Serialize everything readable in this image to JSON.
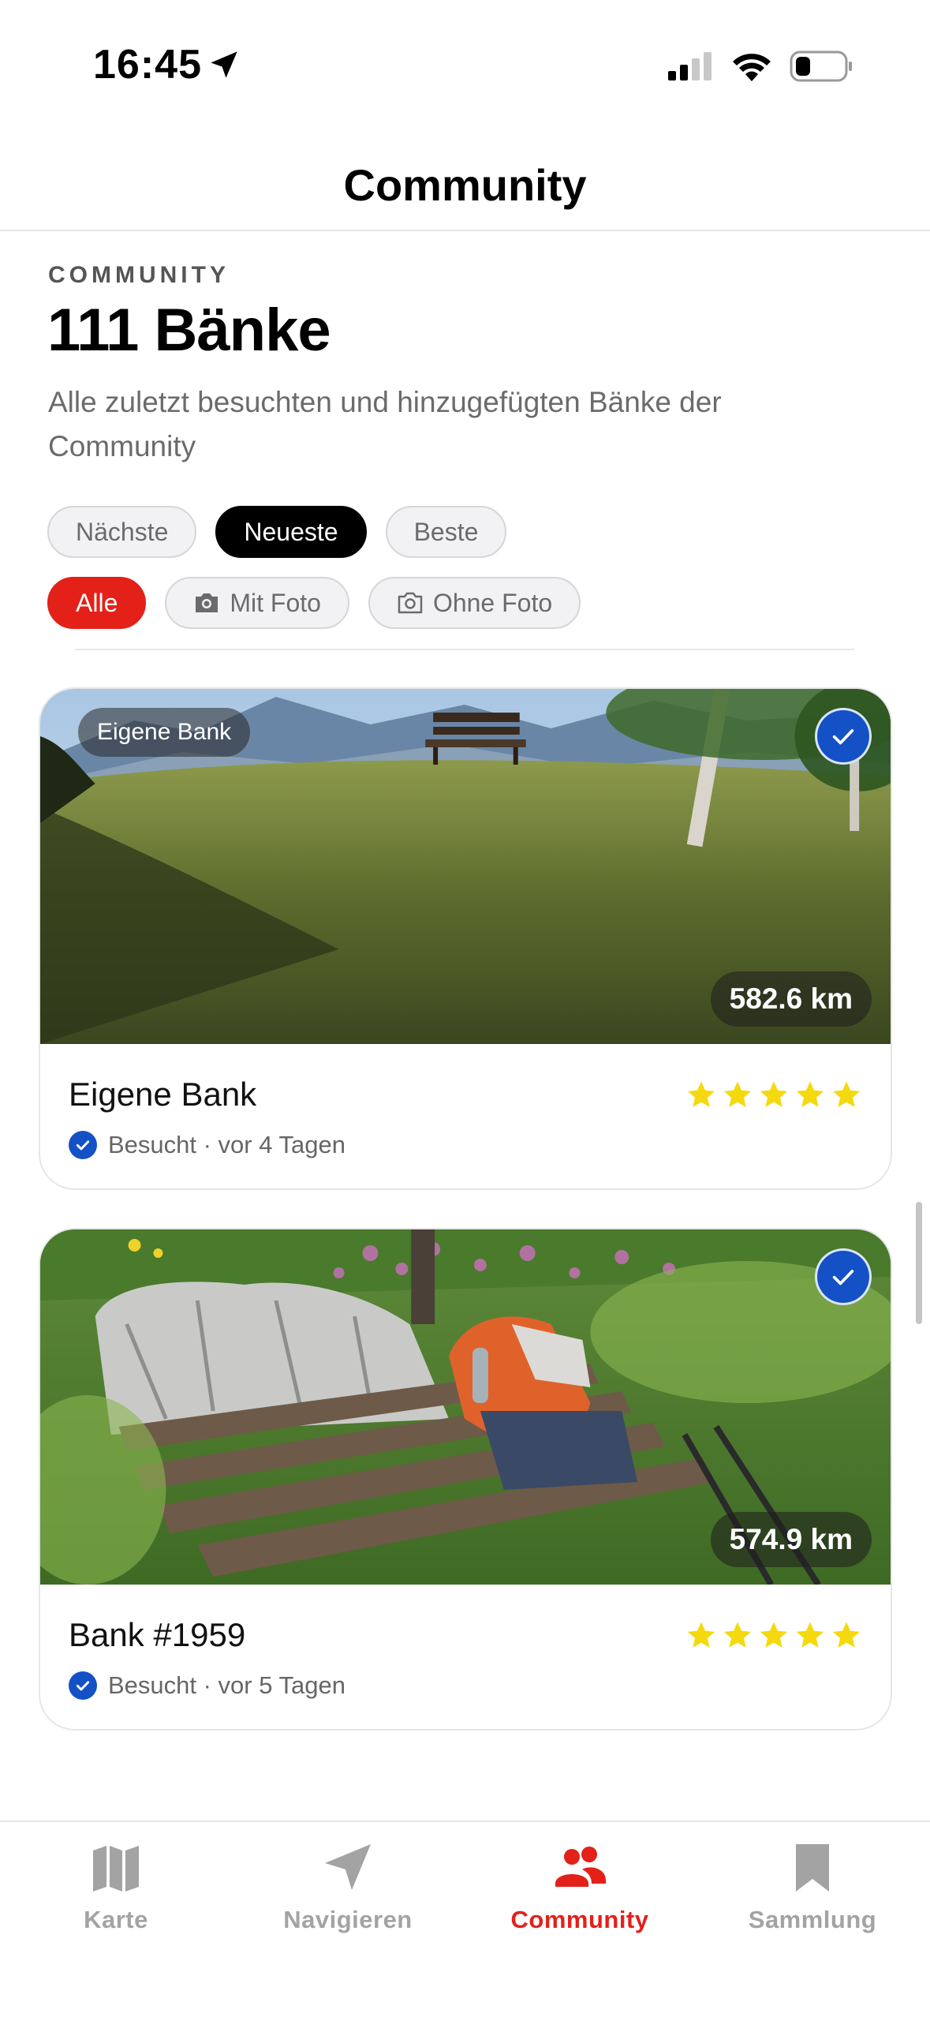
{
  "status_bar": {
    "time": "16:45"
  },
  "nav": {
    "title": "Community"
  },
  "header": {
    "eyebrow": "COMMUNITY",
    "title": "111 Bänke",
    "subtitle": "Alle zuletzt besuchten und hinzugefügten Bänke der Community"
  },
  "sort_chips": [
    {
      "label": "Nächste",
      "selected": false
    },
    {
      "label": "Neueste",
      "selected": true
    },
    {
      "label": "Beste",
      "selected": false
    }
  ],
  "filter_chips": [
    {
      "label": "Alle",
      "selected": true
    },
    {
      "label": "Mit Foto",
      "icon": "camera-filled-icon",
      "selected": false
    },
    {
      "label": "Ohne Foto",
      "icon": "camera-outline-icon",
      "selected": false
    }
  ],
  "cards": [
    {
      "badge": "Eigene Bank",
      "distance": "582.6 km",
      "title": "Eigene Bank",
      "rating": 5,
      "meta": "Besucht · vor 4 Tagen",
      "visited": true
    },
    {
      "distance": "574.9 km",
      "title": "Bank #1959",
      "rating": 5,
      "meta": "Besucht · vor 5 Tagen",
      "visited": true
    }
  ],
  "tabs": [
    {
      "label": "Karte",
      "icon": "map-icon",
      "active": false
    },
    {
      "label": "Navigieren",
      "icon": "navigation-arrow-icon",
      "active": false
    },
    {
      "label": "Community",
      "icon": "people-icon",
      "active": true
    },
    {
      "label": "Sammlung",
      "icon": "bookmark-icon",
      "active": false
    }
  ],
  "colors": {
    "accent": "#e32119",
    "check_blue": "#1451c6",
    "star": "#f5d90f"
  }
}
